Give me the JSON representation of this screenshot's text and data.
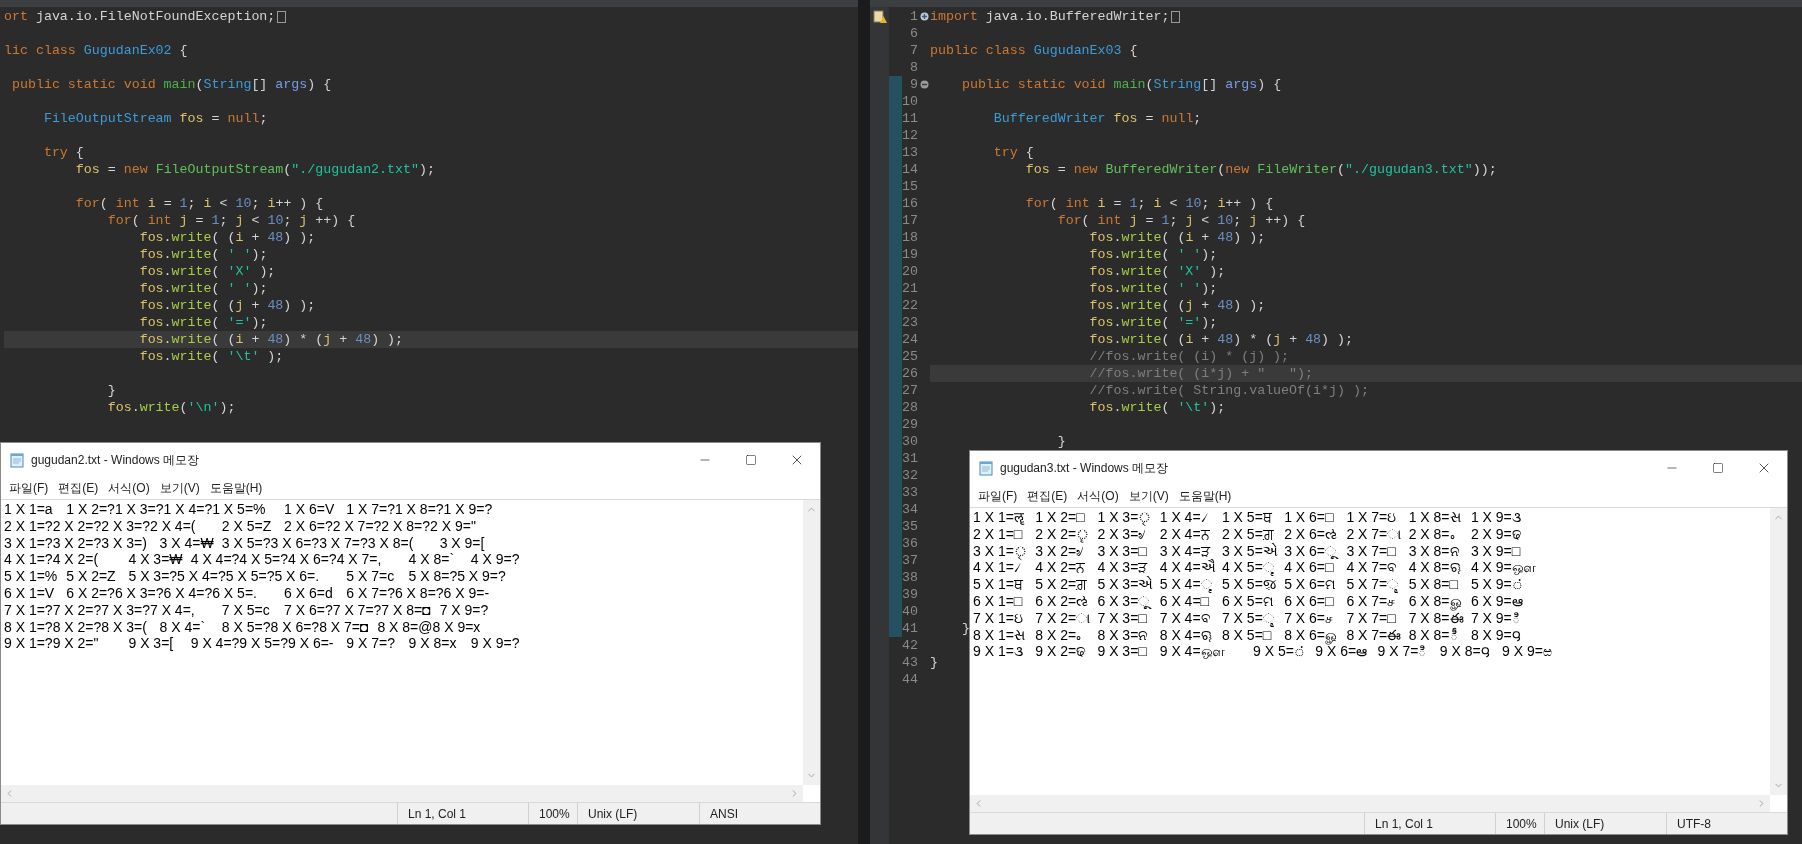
{
  "left_editor": {
    "lines": [
      {
        "tokens": [
          {
            "kind": "kw",
            "text": "ort"
          },
          {
            "kind": "plain",
            "text": " java.io.FileNotFoundException;"
          }
        ],
        "expanded": false,
        "current": false
      },
      {
        "current": false
      },
      {
        "tokens": [
          {
            "kind": "kw",
            "text": "lic class "
          },
          {
            "kind": "type",
            "text": "GugudanEx02"
          },
          {
            "kind": "plain",
            "text": " {"
          }
        ],
        "current": false
      },
      {
        "current": false
      },
      {
        "tokens": [
          {
            "kind": "kw",
            "text": " public static void "
          },
          {
            "kind": "decl",
            "text": "main"
          },
          {
            "kind": "plain",
            "text": "("
          },
          {
            "kind": "type",
            "text": "String"
          },
          {
            "kind": "plain",
            "text": "[] "
          },
          {
            "kind": "param",
            "text": "args"
          },
          {
            "kind": "plain",
            "text": ") {"
          }
        ],
        "current": false
      },
      {
        "current": false
      },
      {
        "tokens": [
          {
            "kind": "type",
            "text": "     FileOutputStream"
          },
          {
            "kind": "var",
            "text": " fos"
          },
          {
            "kind": "plain",
            "text": " = "
          },
          {
            "kind": "kw",
            "text": "null"
          },
          {
            "kind": "plain",
            "text": ";"
          }
        ],
        "current": false
      },
      {
        "current": false
      },
      {
        "tokens": [
          {
            "kind": "kw",
            "text": "     try"
          },
          {
            "kind": "plain",
            "text": " {"
          }
        ],
        "current": false
      },
      {
        "tokens": [
          {
            "kind": "var",
            "text": "         fos"
          },
          {
            "kind": "plain",
            "text": " = "
          },
          {
            "kind": "kw",
            "text": "new"
          },
          {
            "kind": "ctor",
            "text": " FileOutputStream"
          },
          {
            "kind": "plain",
            "text": "("
          },
          {
            "kind": "str",
            "text": "\"./gugudan2.txt\""
          },
          {
            "kind": "plain",
            "text": ");"
          }
        ],
        "current": false
      },
      {
        "current": false
      },
      {
        "tokens": [
          {
            "kind": "kw",
            "text": "         for"
          },
          {
            "kind": "plain",
            "text": "( "
          },
          {
            "kind": "kw",
            "text": "int"
          },
          {
            "kind": "var",
            "text": " i"
          },
          {
            "kind": "plain",
            "text": " = "
          },
          {
            "kind": "num",
            "text": "1"
          },
          {
            "kind": "plain",
            "text": "; "
          },
          {
            "kind": "var",
            "text": "i"
          },
          {
            "kind": "plain",
            "text": " < "
          },
          {
            "kind": "num",
            "text": "10"
          },
          {
            "kind": "plain",
            "text": "; "
          },
          {
            "kind": "var",
            "text": "i"
          },
          {
            "kind": "plain",
            "text": "++ ) {"
          }
        ],
        "current": false
      },
      {
        "tokens": [
          {
            "kind": "kw",
            "text": "             for"
          },
          {
            "kind": "plain",
            "text": "( "
          },
          {
            "kind": "kw",
            "text": "int"
          },
          {
            "kind": "var",
            "text": " j"
          },
          {
            "kind": "plain",
            "text": " = "
          },
          {
            "kind": "num",
            "text": "1"
          },
          {
            "kind": "plain",
            "text": "; "
          },
          {
            "kind": "var",
            "text": "j"
          },
          {
            "kind": "plain",
            "text": " < "
          },
          {
            "kind": "num",
            "text": "10"
          },
          {
            "kind": "plain",
            "text": "; "
          },
          {
            "kind": "var",
            "text": "j"
          },
          {
            "kind": "plain",
            "text": " ++) {"
          }
        ],
        "current": false
      },
      {
        "tokens": [
          {
            "kind": "var",
            "text": "                 fos"
          },
          {
            "kind": "plain",
            "text": "."
          },
          {
            "kind": "method",
            "text": "write"
          },
          {
            "kind": "plain",
            "text": "( ("
          },
          {
            "kind": "var",
            "text": "i"
          },
          {
            "kind": "plain",
            "text": " + "
          },
          {
            "kind": "num",
            "text": "48"
          },
          {
            "kind": "plain",
            "text": ") );"
          }
        ],
        "current": false
      },
      {
        "tokens": [
          {
            "kind": "var",
            "text": "                 fos"
          },
          {
            "kind": "plain",
            "text": "."
          },
          {
            "kind": "method",
            "text": "write"
          },
          {
            "kind": "plain",
            "text": "( "
          },
          {
            "kind": "str",
            "text": "' '"
          },
          {
            "kind": "plain",
            "text": ");"
          }
        ],
        "current": false
      },
      {
        "tokens": [
          {
            "kind": "var",
            "text": "                 fos"
          },
          {
            "kind": "plain",
            "text": "."
          },
          {
            "kind": "method",
            "text": "write"
          },
          {
            "kind": "plain",
            "text": "( "
          },
          {
            "kind": "str",
            "text": "'X'"
          },
          {
            "kind": "plain",
            "text": " );"
          }
        ],
        "current": false
      },
      {
        "tokens": [
          {
            "kind": "var",
            "text": "                 fos"
          },
          {
            "kind": "plain",
            "text": "."
          },
          {
            "kind": "method",
            "text": "write"
          },
          {
            "kind": "plain",
            "text": "( "
          },
          {
            "kind": "str",
            "text": "' '"
          },
          {
            "kind": "plain",
            "text": ");"
          }
        ],
        "current": false
      },
      {
        "tokens": [
          {
            "kind": "var",
            "text": "                 fos"
          },
          {
            "kind": "plain",
            "text": "."
          },
          {
            "kind": "method",
            "text": "write"
          },
          {
            "kind": "plain",
            "text": "( ("
          },
          {
            "kind": "var",
            "text": "j"
          },
          {
            "kind": "plain",
            "text": " + "
          },
          {
            "kind": "num",
            "text": "48"
          },
          {
            "kind": "plain",
            "text": ") );"
          }
        ],
        "current": false
      },
      {
        "tokens": [
          {
            "kind": "var",
            "text": "                 fos"
          },
          {
            "kind": "plain",
            "text": "."
          },
          {
            "kind": "method",
            "text": "write"
          },
          {
            "kind": "plain",
            "text": "( "
          },
          {
            "kind": "str",
            "text": "'='"
          },
          {
            "kind": "plain",
            "text": ");"
          }
        ],
        "current": false
      },
      {
        "tokens": [
          {
            "kind": "var",
            "text": "                 fos"
          },
          {
            "kind": "plain",
            "text": "."
          },
          {
            "kind": "method",
            "text": "write"
          },
          {
            "kind": "plain",
            "text": "( ("
          },
          {
            "kind": "var",
            "text": "i"
          },
          {
            "kind": "plain",
            "text": " + "
          },
          {
            "kind": "num",
            "text": "48"
          },
          {
            "kind": "plain",
            "text": ") * ("
          },
          {
            "kind": "var",
            "text": "j"
          },
          {
            "kind": "plain",
            "text": " + "
          },
          {
            "kind": "num",
            "text": "48"
          },
          {
            "kind": "plain",
            "text": ") );"
          }
        ],
        "current": true
      },
      {
        "tokens": [
          {
            "kind": "var",
            "text": "                 fos"
          },
          {
            "kind": "plain",
            "text": "."
          },
          {
            "kind": "method",
            "text": "write"
          },
          {
            "kind": "plain",
            "text": "( "
          },
          {
            "kind": "str",
            "text": "'\\t'"
          },
          {
            "kind": "plain",
            "text": " );"
          }
        ],
        "current": false
      },
      {
        "current": false
      },
      {
        "tokens": [
          {
            "kind": "plain",
            "text": "             }"
          }
        ],
        "current": false
      },
      {
        "tokens": [
          {
            "kind": "var",
            "text": "             fos"
          },
          {
            "kind": "plain",
            "text": "."
          },
          {
            "kind": "method",
            "text": "write"
          },
          {
            "kind": "plain",
            "text": "("
          },
          {
            "kind": "str",
            "text": "'\\n'"
          },
          {
            "kind": "plain",
            "text": ");"
          }
        ],
        "current": false
      }
    ]
  },
  "right_editor": {
    "lines": [
      {
        "number": "1",
        "warning": true,
        "expanded": false,
        "changed": false,
        "current": false,
        "tokens": [
          {
            "kind": "kw",
            "text": "import"
          },
          {
            "kind": "plain",
            "text": " java.io.BufferedWriter;"
          }
        ]
      },
      {
        "number": "6",
        "changed": false,
        "current": false
      },
      {
        "number": "7",
        "changed": false,
        "current": false,
        "tokens": [
          {
            "kind": "kw",
            "text": "public class "
          },
          {
            "kind": "type",
            "text": "GugudanEx03"
          },
          {
            "kind": "plain",
            "text": " {"
          }
        ]
      },
      {
        "number": "8",
        "changed": false,
        "current": false
      },
      {
        "number": "9",
        "expanded": true,
        "changed": true,
        "current": false,
        "tokens": [
          {
            "kind": "kw",
            "text": "    public static void "
          },
          {
            "kind": "decl",
            "text": "main"
          },
          {
            "kind": "plain",
            "text": "("
          },
          {
            "kind": "type",
            "text": "String"
          },
          {
            "kind": "plain",
            "text": "[] "
          },
          {
            "kind": "param",
            "text": "args"
          },
          {
            "kind": "plain",
            "text": ") {"
          }
        ]
      },
      {
        "number": "10",
        "changed": true,
        "current": false
      },
      {
        "number": "11",
        "changed": true,
        "current": false,
        "tokens": [
          {
            "kind": "type",
            "text": "        BufferedWriter"
          },
          {
            "kind": "var",
            "text": " fos"
          },
          {
            "kind": "plain",
            "text": " = "
          },
          {
            "kind": "kw",
            "text": "null"
          },
          {
            "kind": "plain",
            "text": ";"
          }
        ]
      },
      {
        "number": "12",
        "changed": true,
        "current": false
      },
      {
        "number": "13",
        "changed": true,
        "current": false,
        "tokens": [
          {
            "kind": "kw",
            "text": "        try"
          },
          {
            "kind": "plain",
            "text": " {"
          }
        ]
      },
      {
        "number": "14",
        "changed": true,
        "current": false,
        "tokens": [
          {
            "kind": "var",
            "text": "            fos"
          },
          {
            "kind": "plain",
            "text": " = "
          },
          {
            "kind": "kw",
            "text": "new"
          },
          {
            "kind": "ctor",
            "text": " BufferedWriter"
          },
          {
            "kind": "plain",
            "text": "("
          },
          {
            "kind": "kw",
            "text": "new"
          },
          {
            "kind": "ctor",
            "text": " FileWriter"
          },
          {
            "kind": "plain",
            "text": "("
          },
          {
            "kind": "str",
            "text": "\"./gugudan3.txt\""
          },
          {
            "kind": "plain",
            "text": "));"
          }
        ]
      },
      {
        "number": "15",
        "changed": true,
        "current": false
      },
      {
        "number": "16",
        "changed": true,
        "current": false,
        "tokens": [
          {
            "kind": "kw",
            "text": "            for"
          },
          {
            "kind": "plain",
            "text": "( "
          },
          {
            "kind": "kw",
            "text": "int"
          },
          {
            "kind": "var",
            "text": " i"
          },
          {
            "kind": "plain",
            "text": " = "
          },
          {
            "kind": "num",
            "text": "1"
          },
          {
            "kind": "plain",
            "text": "; "
          },
          {
            "kind": "var",
            "text": "i"
          },
          {
            "kind": "plain",
            "text": " < "
          },
          {
            "kind": "num",
            "text": "10"
          },
          {
            "kind": "plain",
            "text": "; "
          },
          {
            "kind": "var",
            "text": "i"
          },
          {
            "kind": "plain",
            "text": "++ ) {"
          }
        ]
      },
      {
        "number": "17",
        "changed": true,
        "current": false,
        "tokens": [
          {
            "kind": "kw",
            "text": "                for"
          },
          {
            "kind": "plain",
            "text": "( "
          },
          {
            "kind": "kw",
            "text": "int"
          },
          {
            "kind": "var",
            "text": " j"
          },
          {
            "kind": "plain",
            "text": " = "
          },
          {
            "kind": "num",
            "text": "1"
          },
          {
            "kind": "plain",
            "text": "; "
          },
          {
            "kind": "var",
            "text": "j"
          },
          {
            "kind": "plain",
            "text": " < "
          },
          {
            "kind": "num",
            "text": "10"
          },
          {
            "kind": "plain",
            "text": "; "
          },
          {
            "kind": "var",
            "text": "j"
          },
          {
            "kind": "plain",
            "text": " ++) {"
          }
        ]
      },
      {
        "number": "18",
        "changed": true,
        "current": false,
        "tokens": [
          {
            "kind": "var",
            "text": "                    fos"
          },
          {
            "kind": "plain",
            "text": "."
          },
          {
            "kind": "method",
            "text": "write"
          },
          {
            "kind": "plain",
            "text": "( ("
          },
          {
            "kind": "var",
            "text": "i"
          },
          {
            "kind": "plain",
            "text": " + "
          },
          {
            "kind": "num",
            "text": "48"
          },
          {
            "kind": "plain",
            "text": ") );"
          }
        ]
      },
      {
        "number": "19",
        "changed": true,
        "current": false,
        "tokens": [
          {
            "kind": "var",
            "text": "                    fos"
          },
          {
            "kind": "plain",
            "text": "."
          },
          {
            "kind": "method",
            "text": "write"
          },
          {
            "kind": "plain",
            "text": "( "
          },
          {
            "kind": "str",
            "text": "' '"
          },
          {
            "kind": "plain",
            "text": ");"
          }
        ]
      },
      {
        "number": "20",
        "changed": true,
        "current": false,
        "tokens": [
          {
            "kind": "var",
            "text": "                    fos"
          },
          {
            "kind": "plain",
            "text": "."
          },
          {
            "kind": "method",
            "text": "write"
          },
          {
            "kind": "plain",
            "text": "( "
          },
          {
            "kind": "str",
            "text": "'X'"
          },
          {
            "kind": "plain",
            "text": " );"
          }
        ]
      },
      {
        "number": "21",
        "changed": true,
        "current": false,
        "tokens": [
          {
            "kind": "var",
            "text": "                    fos"
          },
          {
            "kind": "plain",
            "text": "."
          },
          {
            "kind": "method",
            "text": "write"
          },
          {
            "kind": "plain",
            "text": "( "
          },
          {
            "kind": "str",
            "text": "' '"
          },
          {
            "kind": "plain",
            "text": ");"
          }
        ]
      },
      {
        "number": "22",
        "changed": true,
        "current": false,
        "tokens": [
          {
            "kind": "var",
            "text": "                    fos"
          },
          {
            "kind": "plain",
            "text": "."
          },
          {
            "kind": "method",
            "text": "write"
          },
          {
            "kind": "plain",
            "text": "( ("
          },
          {
            "kind": "var",
            "text": "j"
          },
          {
            "kind": "plain",
            "text": " + "
          },
          {
            "kind": "num",
            "text": "48"
          },
          {
            "kind": "plain",
            "text": ") );"
          }
        ]
      },
      {
        "number": "23",
        "changed": true,
        "current": false,
        "tokens": [
          {
            "kind": "var",
            "text": "                    fos"
          },
          {
            "kind": "plain",
            "text": "."
          },
          {
            "kind": "method",
            "text": "write"
          },
          {
            "kind": "plain",
            "text": "( "
          },
          {
            "kind": "str",
            "text": "'='"
          },
          {
            "kind": "plain",
            "text": ");"
          }
        ]
      },
      {
        "number": "24",
        "changed": true,
        "current": false,
        "tokens": [
          {
            "kind": "var",
            "text": "                    fos"
          },
          {
            "kind": "plain",
            "text": "."
          },
          {
            "kind": "method",
            "text": "write"
          },
          {
            "kind": "plain",
            "text": "( ("
          },
          {
            "kind": "var",
            "text": "i"
          },
          {
            "kind": "plain",
            "text": " + "
          },
          {
            "kind": "num",
            "text": "48"
          },
          {
            "kind": "plain",
            "text": ") * ("
          },
          {
            "kind": "var",
            "text": "j"
          },
          {
            "kind": "plain",
            "text": " + "
          },
          {
            "kind": "num",
            "text": "48"
          },
          {
            "kind": "plain",
            "text": ") );"
          }
        ]
      },
      {
        "number": "25",
        "changed": true,
        "current": false,
        "tokens": [
          {
            "kind": "comment",
            "text": "                    //fos.write( (i) * (j) );"
          }
        ]
      },
      {
        "number": "26",
        "changed": true,
        "current": true,
        "tokens": [
          {
            "kind": "comment",
            "text": "                    //fos.write( (i*j) + \"   \");"
          }
        ]
      },
      {
        "number": "27",
        "changed": true,
        "current": false,
        "tokens": [
          {
            "kind": "comment",
            "text": "                    //fos.write( String.valueOf(i*j) );"
          }
        ]
      },
      {
        "number": "28",
        "changed": true,
        "current": false,
        "tokens": [
          {
            "kind": "var",
            "text": "                    fos"
          },
          {
            "kind": "plain",
            "text": "."
          },
          {
            "kind": "method",
            "text": "write"
          },
          {
            "kind": "plain",
            "text": "( "
          },
          {
            "kind": "str",
            "text": "'\\t'"
          },
          {
            "kind": "plain",
            "text": ");"
          }
        ]
      },
      {
        "number": "29",
        "changed": true,
        "current": false
      },
      {
        "number": "30",
        "changed": true,
        "current": false,
        "tokens": [
          {
            "kind": "plain",
            "text": "                }"
          }
        ]
      },
      {
        "number": "31",
        "changed": true,
        "current": false
      },
      {
        "number": "32",
        "changed": true,
        "current": false
      },
      {
        "number": "33",
        "changed": true,
        "current": false
      },
      {
        "number": "34",
        "changed": true,
        "current": false
      },
      {
        "number": "35",
        "changed": true,
        "current": false
      },
      {
        "number": "36",
        "changed": true,
        "current": false
      },
      {
        "number": "37",
        "changed": true,
        "current": false
      },
      {
        "number": "38",
        "changed": true,
        "current": false
      },
      {
        "number": "39",
        "changed": true,
        "current": false
      },
      {
        "number": "40",
        "changed": true,
        "current": false
      },
      {
        "number": "41",
        "changed": true,
        "current": false,
        "tokens": [
          {
            "kind": "plain",
            "text": "    }"
          }
        ]
      },
      {
        "number": "42",
        "changed": false,
        "current": false
      },
      {
        "number": "43",
        "changed": false,
        "current": false,
        "tokens": [
          {
            "kind": "plain",
            "text": "}"
          }
        ]
      },
      {
        "number": "44",
        "changed": false,
        "current": false
      }
    ]
  },
  "notepads": [
    {
      "title": "gugudan2.txt - Windows 메모장",
      "menu": [
        "파일(F)",
        "편집(E)",
        "서식(O)",
        "보기(V)",
        "도움말(H)"
      ],
      "rows": [
        "1 X 1=a\t1 X 2=?1 X 3=?1 X 4=?1 X 5=%\t1 X 6=V\t1 X 7=?1 X 8=?1 X 9=?",
        "2 X 1=?2 X 2=?2 X 3=?2 X 4=(\t2 X 5=Z\t2 X 6=?2 X 7=?2 X 8=?2 X 9=\"",
        "3 X 1=?3 X 2=?3 X 3=)\t3 X 4=₩\t3 X 5=?3 X 6=?3 X 7=?3 X 8=(\t3 X 9=[",
        "4 X 1=?4 X 2=(\t4 X 3=₩\t4 X 4=?4 X 5=?4 X 6=?4 X 7=,\t4 X 8=`\t4 X 9=?",
        "5 X 1=%\t5 X 2=Z\t5 X 3=?5 X 4=?5 X 5=?5 X 6=.\t5 X 7=c\t5 X 8=?5 X 9=?",
        "6 X 1=V\t6 X 2=?6 X 3=?6 X 4=?6 X 5=.\t6 X 6=d\t6 X 7=?6 X 8=?6 X 9=-",
        "7 X 1=?7 X 2=?7 X 3=?7 X 4=,\t7 X 5=c\t7 X 6=?7 X 7=?7 X 8=◘\t7 X 9=?",
        "8 X 1=?8 X 2=?8 X 3=(\t8 X 4=`\t8 X 5=?8 X 6=?8 X 7=◘\t8 X 8=@8 X 9=x",
        "9 X 1=?9 X 2=\"\t9 X 3=[\t9 X 4=?9 X 5=?9 X 6=-\t9 X 7=?\t9 X 8=x\t9 X 9=?"
      ],
      "status": [
        "Ln 1, Col 1",
        "100%",
        "Unix (LF)",
        "ANSI"
      ]
    },
    {
      "title": "gugudan3.txt - Windows 메모장",
      "menu": [
        "파일(F)",
        "편집(E)",
        "서식(O)",
        "보기(V)",
        "도움말(H)"
      ],
      "rows": [
        "1 X 1=ॡ\t1 X 2=□\t1 X 3=ৃ\t1 X 4=৴\t1 X 5=ਥ\t1 X 6=□\t1 X 7=ઇ\t1 X 8=સ\t1 X 9=૩",
        "2 X 1=□\t2 X 2=ৄ\t2 X 3=৶\t2 X 4=ਨ\t2 X 5=ਗ਼\t2 X 6=ઌ\t2 X 7=ા\t2 X 8=૰\t2 X 9=ଢ",
        "3 X 1=ৃ\t3 X 2=৶\t3 X 3=□\t3 X 4=ੜ\t3 X 5=એ\t3 X 6=ૂ\t3 X 7=□\t3 X 8=ନ\t3 X 9=□",
        "4 X 1=৴\t4 X 2=ਨ\t4 X 3=ੜ\t4 X 4=ઐ\t4 X 5=ૄ\t4 X 6=□\t4 X 7=ବ\t4 X 8=ୠ\t4 X 9=ஔ",
        "5 X 1=ਥ\t5 X 2=ਗ਼\t5 X 3=એ\t5 X 4=ૄ\t5 X 5=ૹ\t5 X 6=ମ\t5 X 7=ୣ\t5 X 8=□\t5 X 9=்",
        "6 X 1=□\t6 X 2=ઌ\t6 X 3=ૂ\t6 X 4=□\t6 X 5=ମ\t6 X 6=□\t6 X 7=ச\t6 X 8=ௐ\t6 X 9=ఆ",
        "7 X 1=ઇ\t7 X 2=ા\t7 X 3=□\t7 X 4=ବ\t7 X 5=ୣ\t7 X 6=ச\t7 X 7=□\t7 X 8=ఈ\t7 X 9=ి",
        "8 X 1=સ\t8 X 2=૰\t8 X 3=ନ\t8 X 4=ୠ\t8 X 5=□\t8 X 6=ௐ\t8 X 7=ఈ\t8 X 8=ీ\t8 X 9=౸",
        "9 X 1=૩\t9 X 2=ଢ\t9 X 3=□\t9 X 4=ஔ\t9 X 5=்\t9 X 6=ఆ\t9 X 7=ి\t9 X 8=౸\t9 X 9=ಱ"
      ],
      "status": [
        "Ln 1, Col 1",
        "100%",
        "Unix (LF)",
        "UTF-8"
      ]
    }
  ]
}
